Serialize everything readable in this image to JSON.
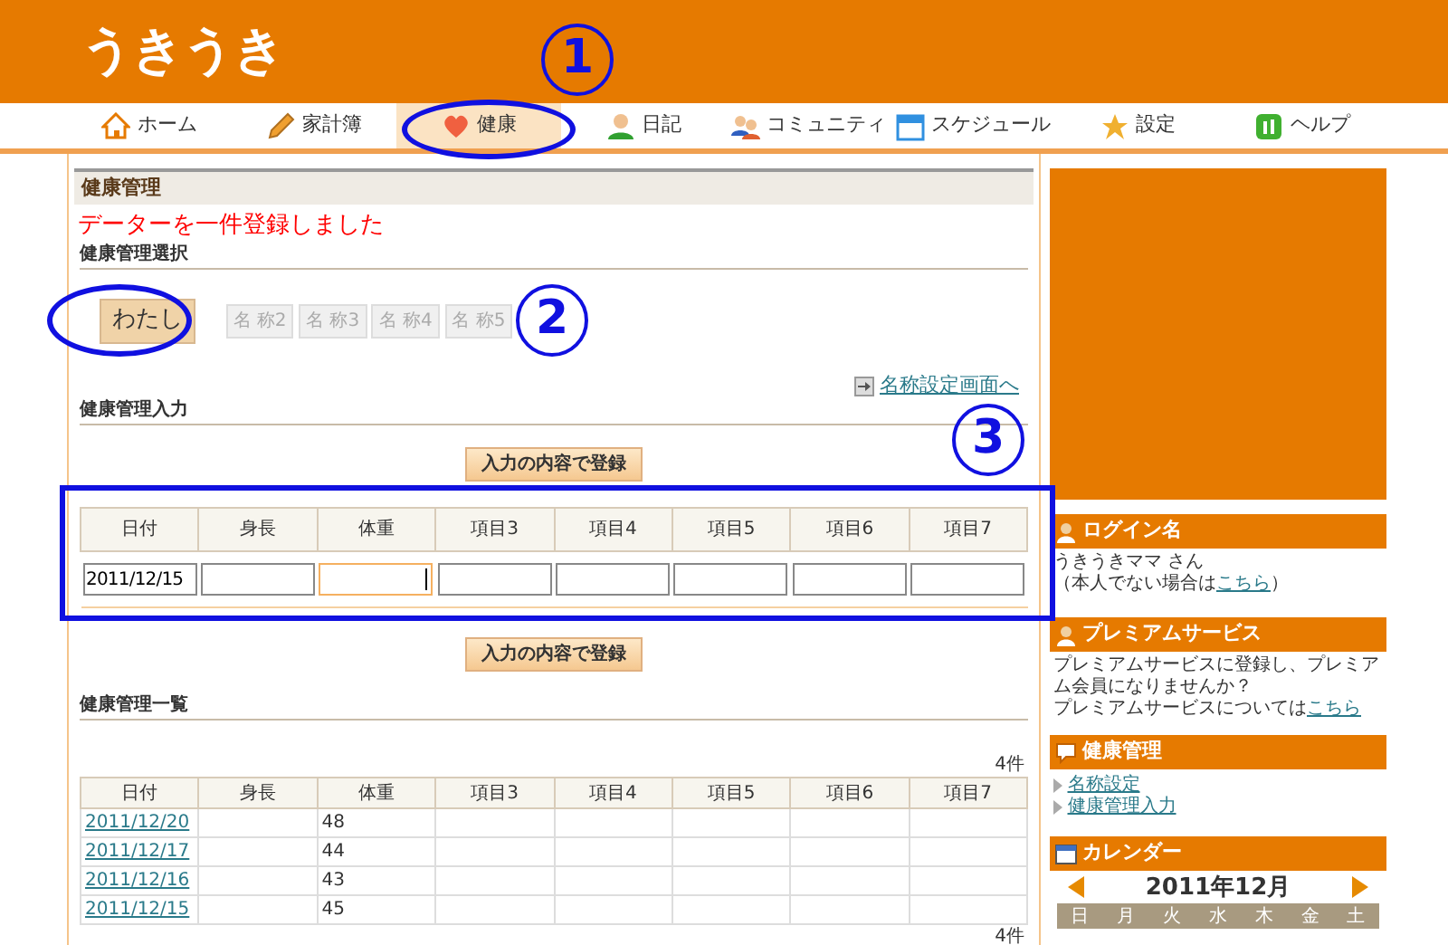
{
  "logo": "うきうき",
  "nav": [
    {
      "label": "ホーム",
      "selected": false
    },
    {
      "label": "家計簿",
      "selected": false
    },
    {
      "label": "健康",
      "selected": true
    },
    {
      "label": "日記",
      "selected": false
    },
    {
      "label": "コミュニティ",
      "selected": false
    },
    {
      "label": "スケジュール",
      "selected": false
    },
    {
      "label": "設定",
      "selected": false
    },
    {
      "label": "ヘルプ",
      "selected": false
    }
  ],
  "main": {
    "title": "健康管理",
    "message": "データーを一件登録しました",
    "select_heading": "健康管理選択",
    "name_tabs": [
      {
        "label": "わたし",
        "selected": true
      },
      {
        "label": "名 称2",
        "selected": false
      },
      {
        "label": "名 称3",
        "selected": false
      },
      {
        "label": "名 称4",
        "selected": false
      },
      {
        "label": "名 称5",
        "selected": false
      }
    ],
    "settings_link": "名称設定画面へ",
    "input_heading": "健康管理入力",
    "submit_top": "入力の内容で登録",
    "input_table": {
      "columns": [
        "日付",
        "身長",
        "体重",
        "項目3",
        "項目4",
        "項目5",
        "項目6",
        "項目7"
      ],
      "fields": [
        {
          "value": "2011/12/15",
          "focused": false
        },
        {
          "focused": false
        },
        {
          "focused": true
        },
        {
          "focused": false
        },
        {
          "focused": false
        },
        {
          "focused": false
        },
        {
          "focused": false
        },
        {
          "focused": false
        }
      ]
    },
    "submit_bottom": "入力の内容で登録",
    "list_heading": "健康管理一覧",
    "count_top": "4件",
    "list_table": {
      "columns": [
        "日付",
        "身長",
        "体重",
        "項目3",
        "項目4",
        "項目5",
        "項目6",
        "項目7"
      ],
      "rows": [
        {
          "date": "2011/12/20",
          "weight": "48"
        },
        {
          "date": "2011/12/17",
          "weight": "44"
        },
        {
          "date": "2011/12/16",
          "weight": "43"
        },
        {
          "date": "2011/12/15",
          "weight": "45"
        }
      ]
    },
    "count_bottom": "4件"
  },
  "sidebar": {
    "login": {
      "title": "ログイン名",
      "user": "うきうきママ さん",
      "note_prefix": "（本人でない場合は",
      "note_link": "こちら",
      "note_suffix": "）"
    },
    "premium": {
      "title": "プレミアムサービス",
      "text": "プレミアムサービスに登録し、プレミアム会員になりませんか？",
      "more_prefix": "プレミアムサービスについては",
      "more_link": "こちら"
    },
    "health": {
      "title": "健康管理",
      "links": [
        "名称設定",
        "健康管理入力"
      ]
    },
    "calendar": {
      "title": "カレンダー",
      "month": "2011年12月",
      "weekdays": [
        "日",
        "月",
        "火",
        "水",
        "木",
        "金",
        "土"
      ]
    }
  },
  "annotations": [
    {
      "label": "1"
    },
    {
      "label": "2"
    },
    {
      "label": "3"
    }
  ]
}
